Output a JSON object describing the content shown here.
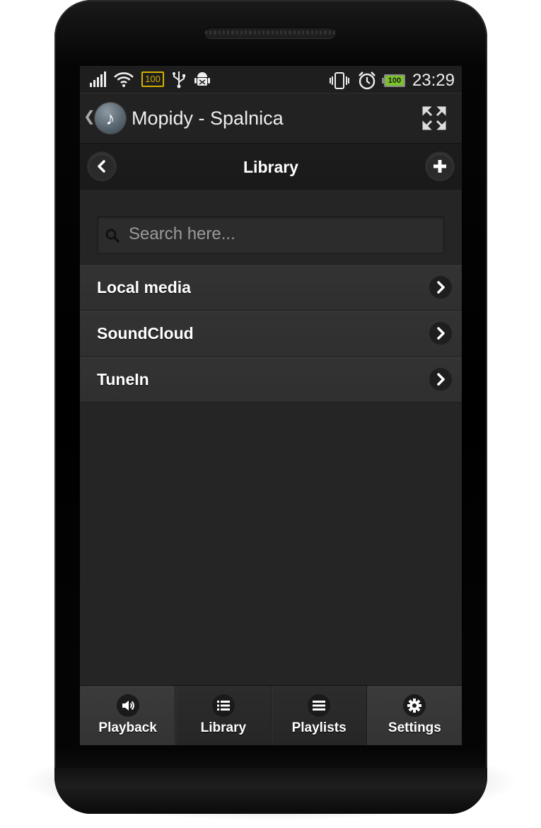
{
  "status_bar": {
    "battery_left": "100",
    "battery_right": "100",
    "time": "23:29",
    "icons": [
      "signal-icon",
      "wifi-icon",
      "battery-icon",
      "usb-icon",
      "android-debug-icon",
      "vibrate-icon",
      "alarm-icon",
      "battery-icon"
    ]
  },
  "action_bar": {
    "title": "Mopidy - Spalnica",
    "icons": [
      "music-note-icon",
      "fullscreen-icon"
    ]
  },
  "header": {
    "title": "Library"
  },
  "search": {
    "placeholder": "Search here...",
    "value": ""
  },
  "library_items": [
    {
      "label": "Local media"
    },
    {
      "label": "SoundCloud"
    },
    {
      "label": "TuneIn"
    }
  ],
  "tabs": [
    {
      "label": "Playback",
      "icon": "speaker-icon"
    },
    {
      "label": "Library",
      "icon": "list-icon"
    },
    {
      "label": "Playlists",
      "icon": "bars-icon"
    },
    {
      "label": "Settings",
      "icon": "gear-icon"
    }
  ],
  "colors": {
    "screen_bg": "#252525",
    "list_item_bg": "#333333",
    "battery_low_accent": "#d4b100",
    "battery_full_accent": "#7cc32a"
  }
}
